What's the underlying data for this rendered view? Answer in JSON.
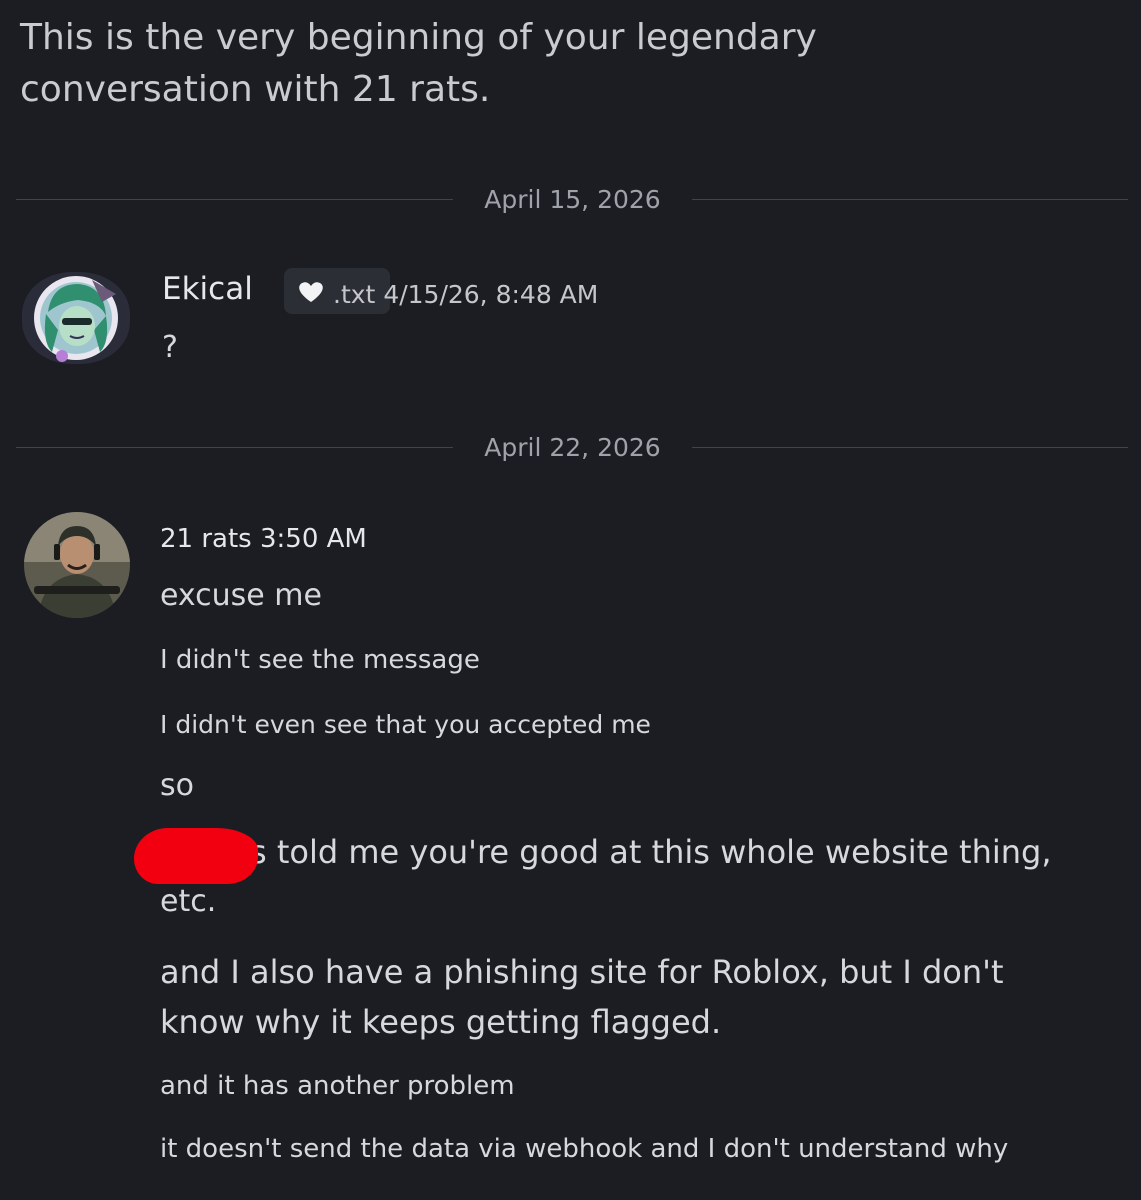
{
  "intro_text": [
    "This is the very beginning of your legendary",
    "conversation with 21 rats."
  ],
  "dividers": [
    "April 15, 2026",
    "April 22, 2026"
  ],
  "message_groups": [
    {
      "username": "Ekical",
      "tag": ".txt",
      "timestamp": "4/15/26, 8:48 AM",
      "messages": [
        "?"
      ]
    },
    {
      "username": "21 rats",
      "timestamp": "3:50 AM",
      "messages": [
        "excuse me",
        "I didn't see the message",
        "I didn't even see that you accepted me",
        "so",
        "s told me you're good at this whole website thing,",
        "etc.",
        "and I also have a phishing site for Roblox, but I don't",
        "know why it keeps getting flagged.",
        "and it has another problem",
        "it doesn't send the data via webhook and I don't understand why"
      ]
    }
  ],
  "icons": {
    "tag_icon": "heart-icon",
    "redaction_color": "#f2000f"
  },
  "colors": {
    "background": "#1c1d22",
    "text": "#d6d8de",
    "divider": "#3f434c"
  }
}
